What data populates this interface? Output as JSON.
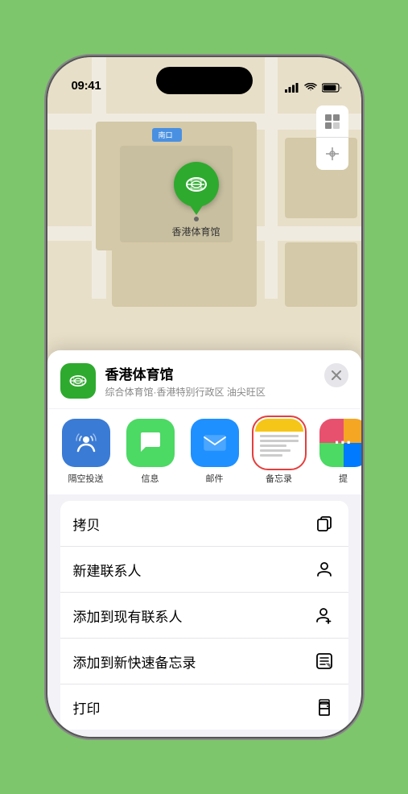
{
  "statusBar": {
    "time": "09:41",
    "locationArrow": true
  },
  "map": {
    "entranceLabel": "南口",
    "pinLabel": "香港体育馆"
  },
  "locationHeader": {
    "name": "香港体育馆",
    "subtitle": "综合体育馆·香港特别行政区 油尖旺区",
    "closeLabel": "×"
  },
  "shareItems": [
    {
      "id": "airdrop",
      "label": "隔空投送"
    },
    {
      "id": "message",
      "label": "信息"
    },
    {
      "id": "mail",
      "label": "邮件"
    },
    {
      "id": "notes",
      "label": "备忘录"
    },
    {
      "id": "more",
      "label": "提"
    }
  ],
  "actionItems": [
    {
      "id": "copy",
      "label": "拷贝",
      "icon": "copy"
    },
    {
      "id": "new-contact",
      "label": "新建联系人",
      "icon": "person-add"
    },
    {
      "id": "add-to-contact",
      "label": "添加到现有联系人",
      "icon": "person-plus"
    },
    {
      "id": "add-to-notes",
      "label": "添加到新快速备忘录",
      "icon": "notes"
    },
    {
      "id": "print",
      "label": "打印",
      "icon": "print"
    }
  ]
}
